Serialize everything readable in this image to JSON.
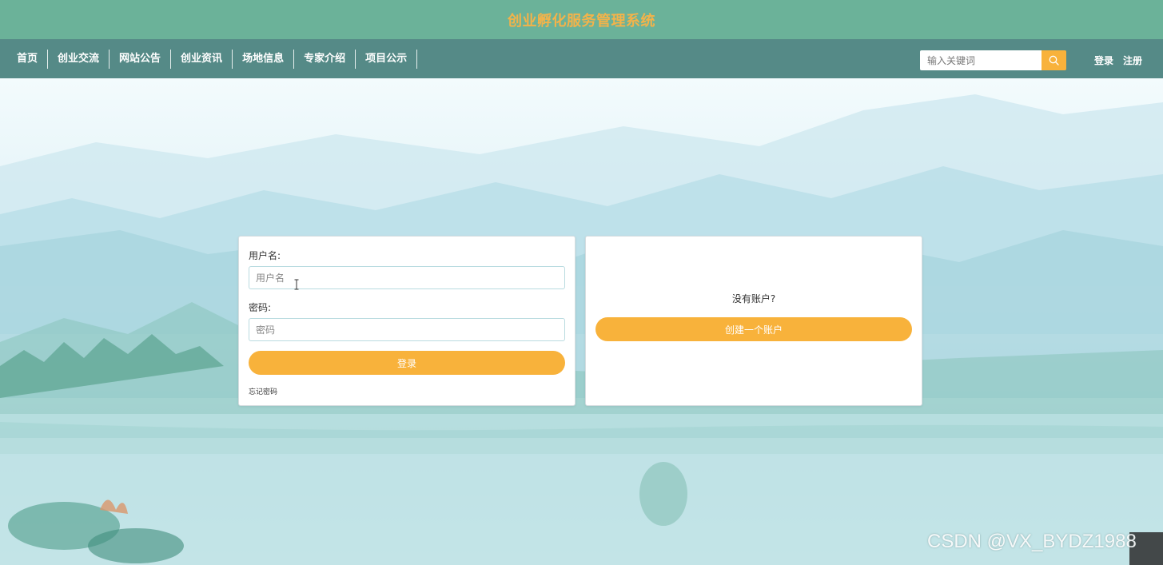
{
  "site": {
    "title": "创业孵化服务管理系统"
  },
  "nav": {
    "items": [
      {
        "label": "首页"
      },
      {
        "label": "创业交流"
      },
      {
        "label": "网站公告"
      },
      {
        "label": "创业资讯"
      },
      {
        "label": "场地信息"
      },
      {
        "label": "专家介绍"
      },
      {
        "label": "项目公示"
      }
    ]
  },
  "search": {
    "placeholder": "输入关键词",
    "value": ""
  },
  "auth": {
    "login_label": "登录",
    "register_label": "注册"
  },
  "login_form": {
    "username_label": "用户名:",
    "username_placeholder": "用户名",
    "password_label": "密码:",
    "password_placeholder": "密码",
    "submit_label": "登录",
    "forgot_label": "忘记密码"
  },
  "register_panel": {
    "prompt": "没有账户?",
    "button_label": "创建一个账户"
  },
  "watermark": "CSDN @VX_BYDZ1988",
  "colors": {
    "title_bar": "#6bb299",
    "nav_bar": "#558a87",
    "accent": "#f8b23b",
    "title_text": "#f3b34a"
  },
  "icons": {
    "search": "search-icon"
  }
}
